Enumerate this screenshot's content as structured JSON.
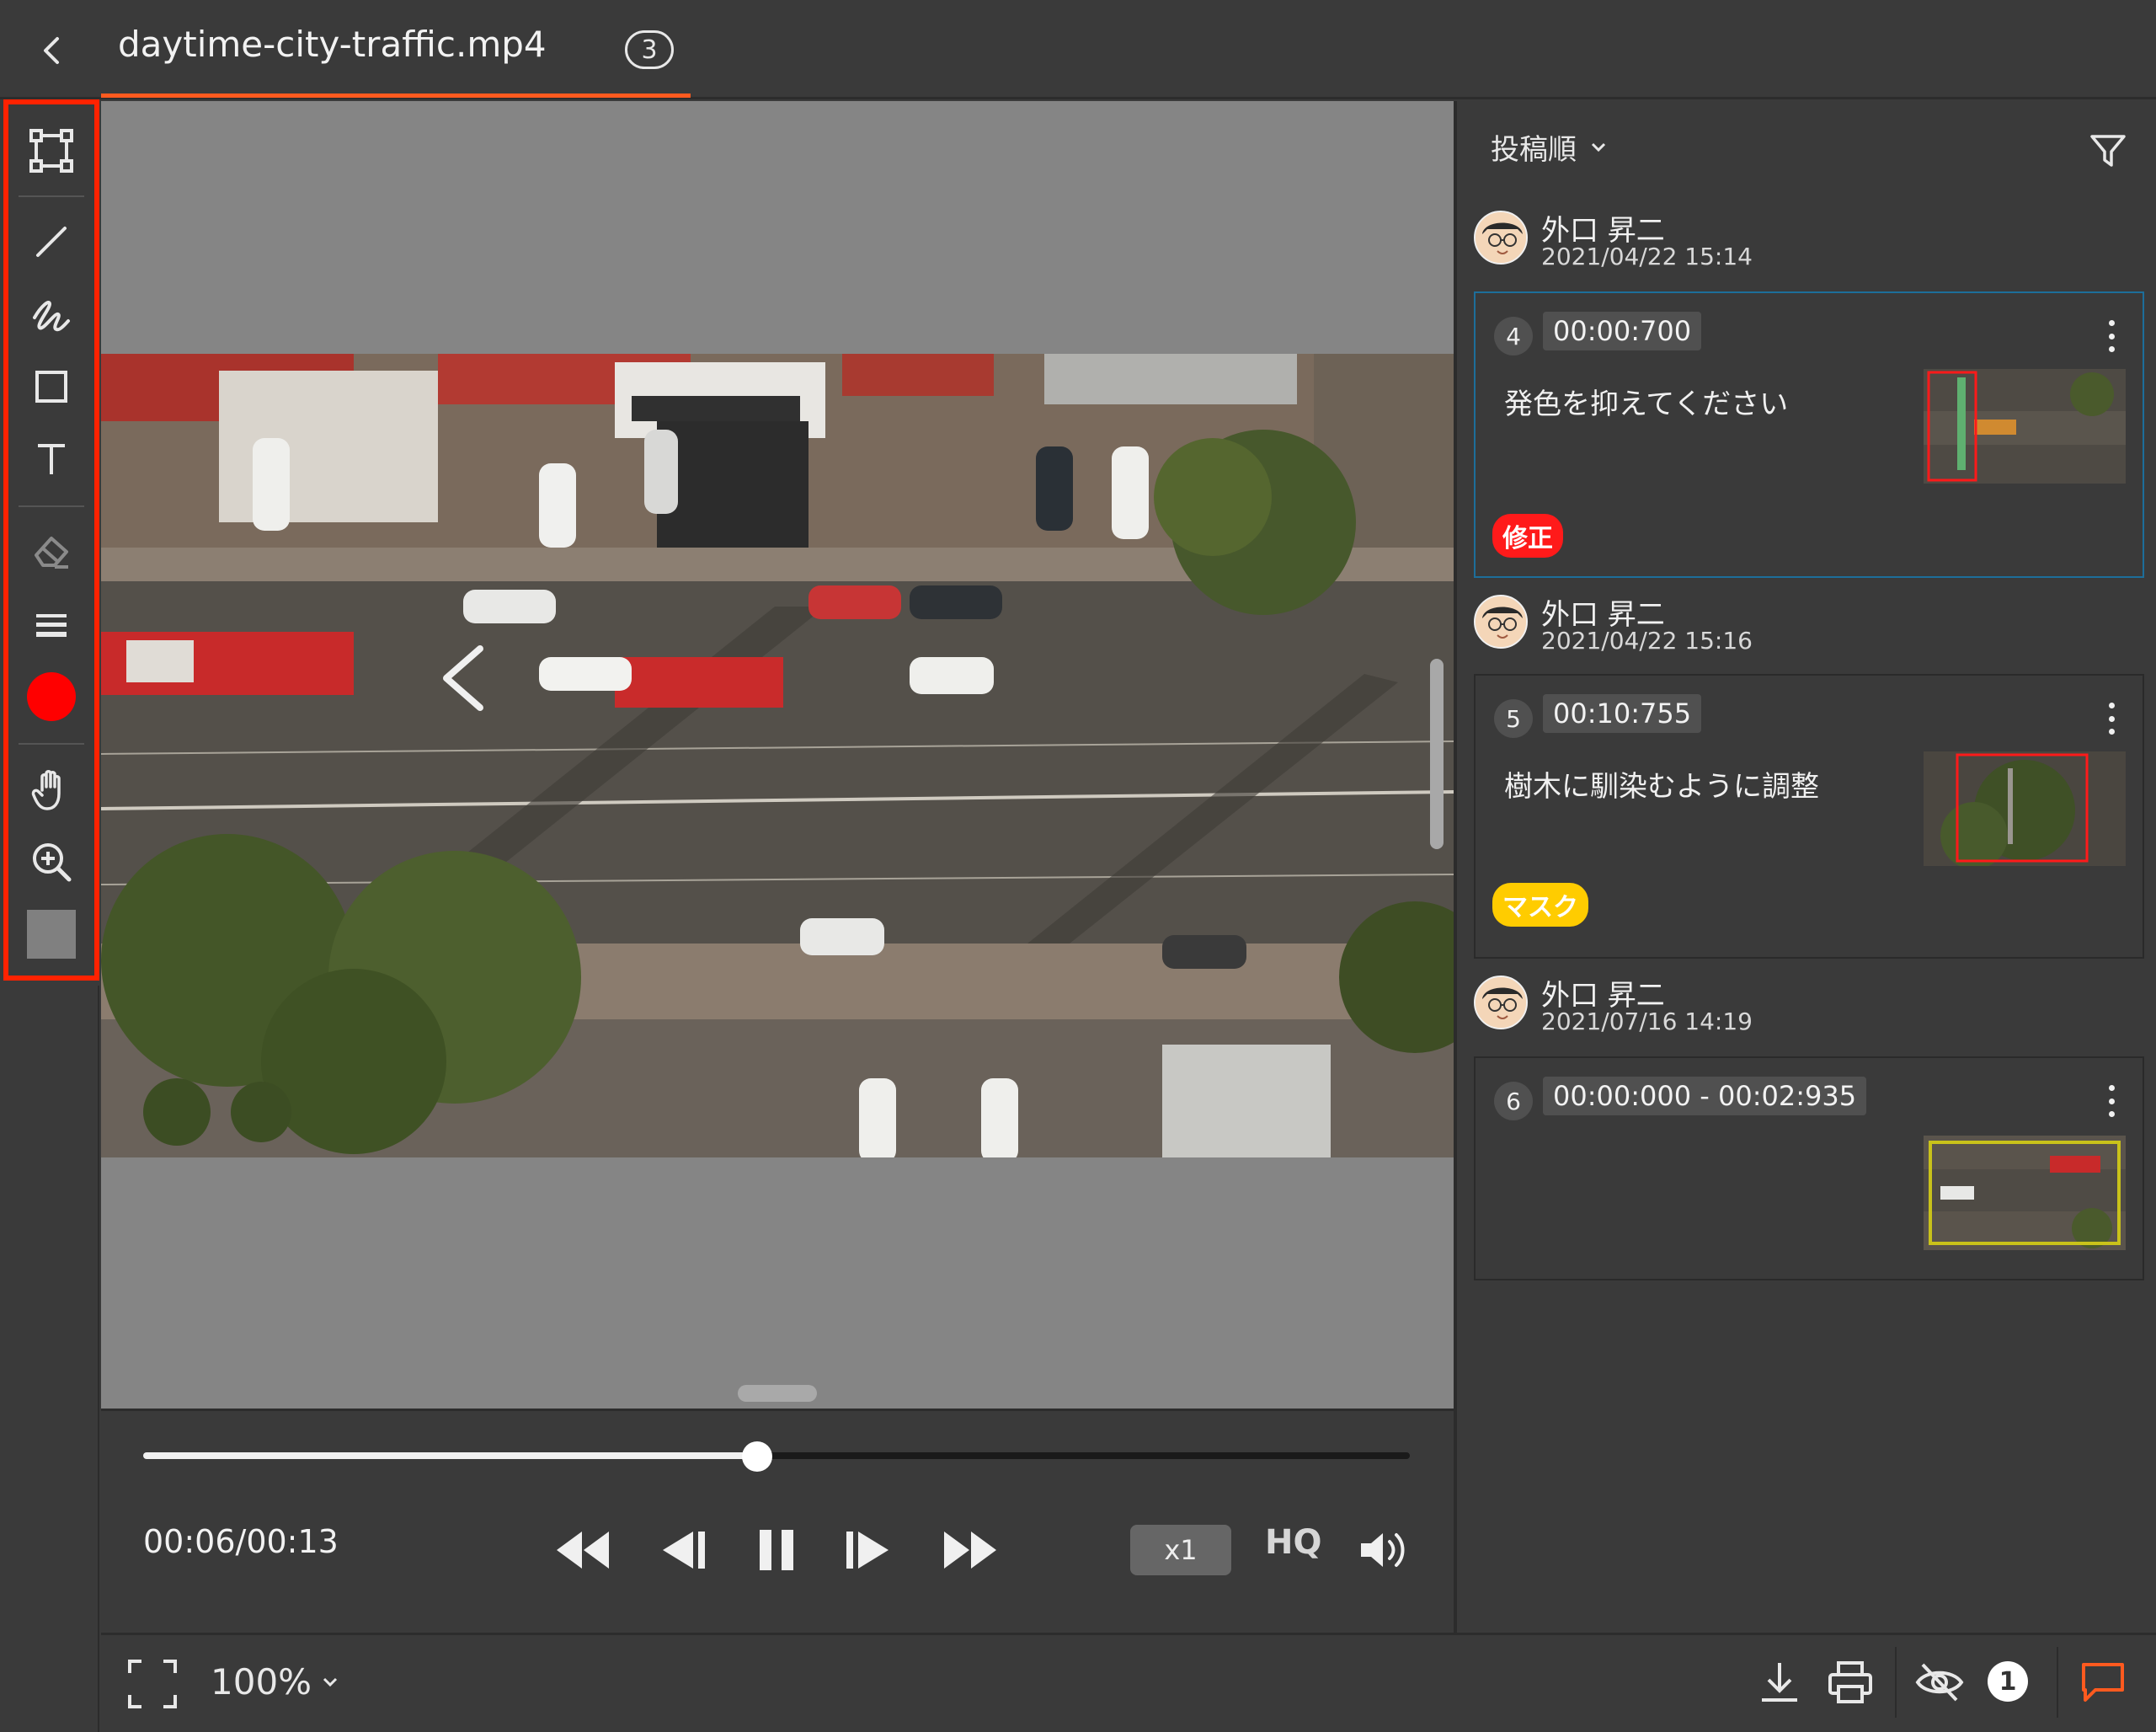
{
  "header": {
    "file_title": "daytime-city-traffic.mp4",
    "version_badge": "3"
  },
  "player": {
    "time_display": "00:06/00:13",
    "progress": 0.485,
    "speed": "x1",
    "quality": "HQ"
  },
  "toolbar": {
    "tools": [
      "select-transform",
      "line",
      "pen",
      "rectangle",
      "text",
      "eraser",
      "line-width",
      "color",
      "hand",
      "zoom-in",
      "fill"
    ],
    "active_color": "#ff0000",
    "fill_color": "#808080"
  },
  "bottom": {
    "zoom_level": "100%",
    "hidden_count": "1"
  },
  "panel": {
    "sort_label": "投稿順",
    "comments": [
      {
        "author": "外口 昇二",
        "date": "2021/04/22 15:14",
        "number": "4",
        "timestamp": "00:00:700",
        "text": "発色を抑えてください",
        "tag": "修正",
        "tag_color": "#ff1a1a",
        "tag_text_color": "#ffffff"
      },
      {
        "author": "外口 昇二",
        "date": "2021/04/22 15:16",
        "number": "5",
        "timestamp": "00:10:755",
        "text": "樹木に馴染むように調整",
        "tag": "マスク",
        "tag_color": "#ffcc00",
        "tag_text_color": "#ffffff"
      },
      {
        "author": "外口 昇二",
        "date": "2021/07/16 14:19",
        "number": "6",
        "timestamp": "00:00:000 - 00:02:935",
        "text": "",
        "tag": "",
        "tag_color": "",
        "tag_text_color": ""
      }
    ]
  },
  "colors": {
    "accent": "#ff5a1f",
    "toolbar_highlight": "#ff2200",
    "selected_card_border": "#1d6e9a",
    "background": "#3a3a3a"
  }
}
